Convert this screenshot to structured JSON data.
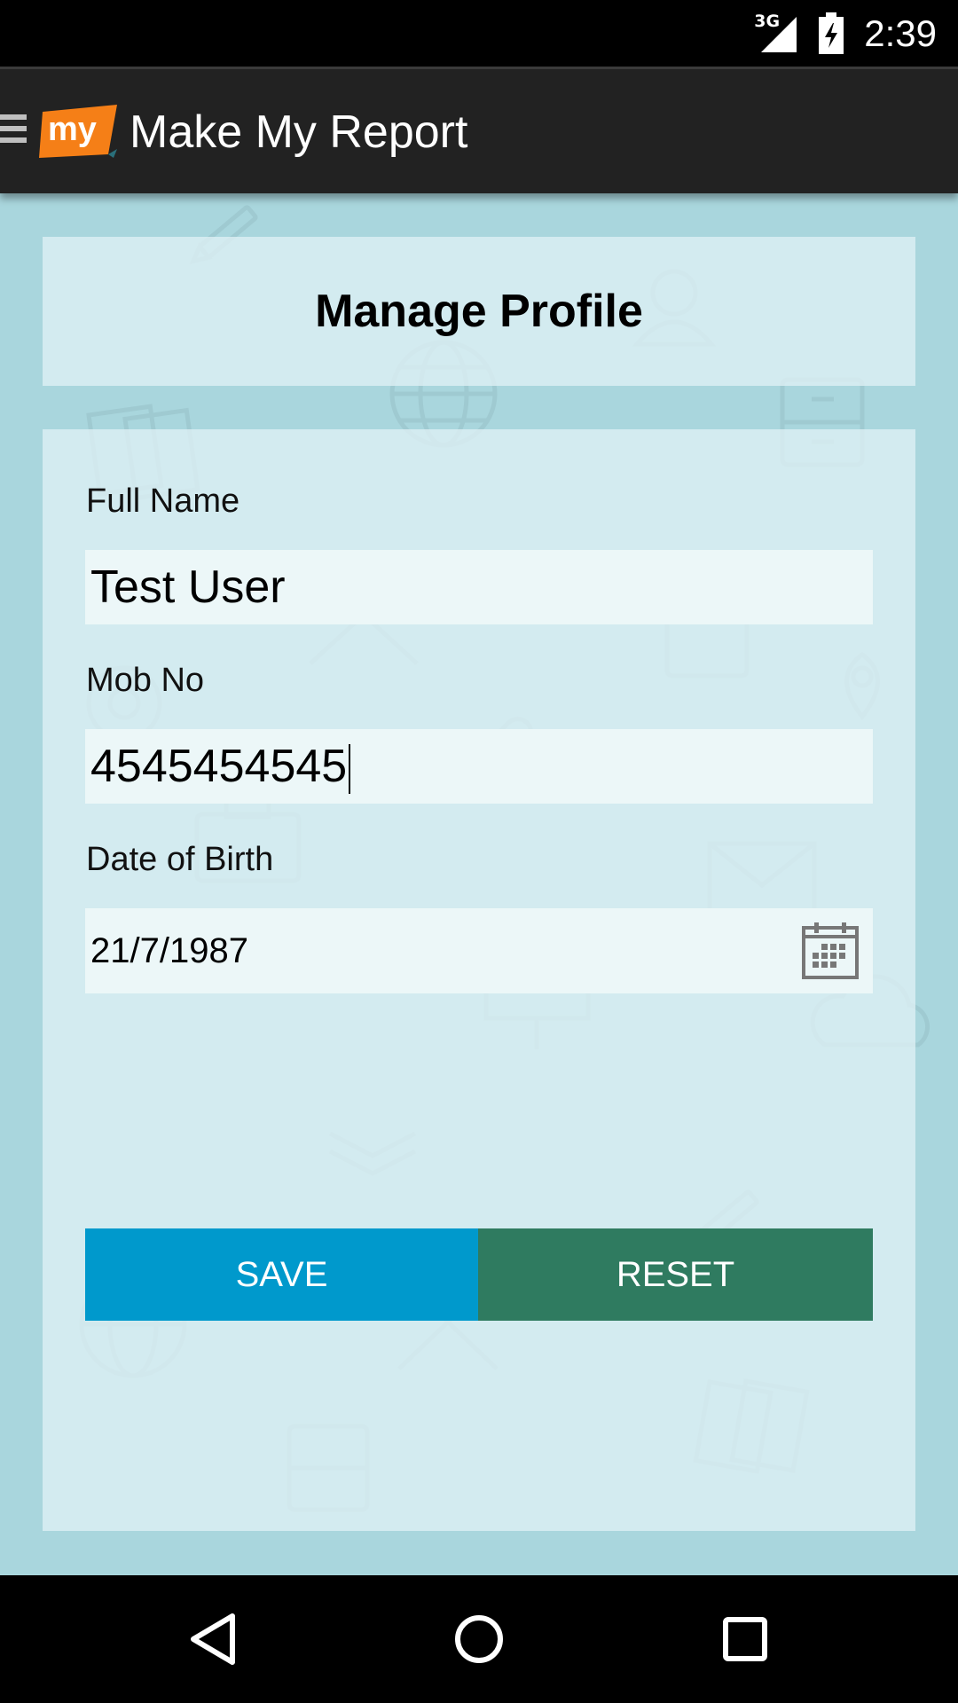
{
  "status_bar": {
    "network": "3G",
    "time": "2:39"
  },
  "app_bar": {
    "logo_text": "my",
    "title": "Make My Report"
  },
  "page": {
    "title": "Manage Profile"
  },
  "form": {
    "full_name": {
      "label": "Full Name",
      "value": "Test User"
    },
    "mobile": {
      "label": "Mob No",
      "value": "4545454545"
    },
    "dob": {
      "label": "Date of Birth",
      "value": "21/7/1987"
    },
    "save_label": "SAVE",
    "reset_label": "RESET"
  },
  "colors": {
    "save_button": "#0099cc",
    "reset_button": "#2f7b60",
    "logo_orange": "#f57f17",
    "background": "#a9d6dd"
  },
  "icons": [
    "hamburger-icon",
    "logo-icon",
    "calendar-icon",
    "back-icon",
    "home-icon",
    "recents-icon",
    "signal-icon",
    "battery-icon"
  ]
}
